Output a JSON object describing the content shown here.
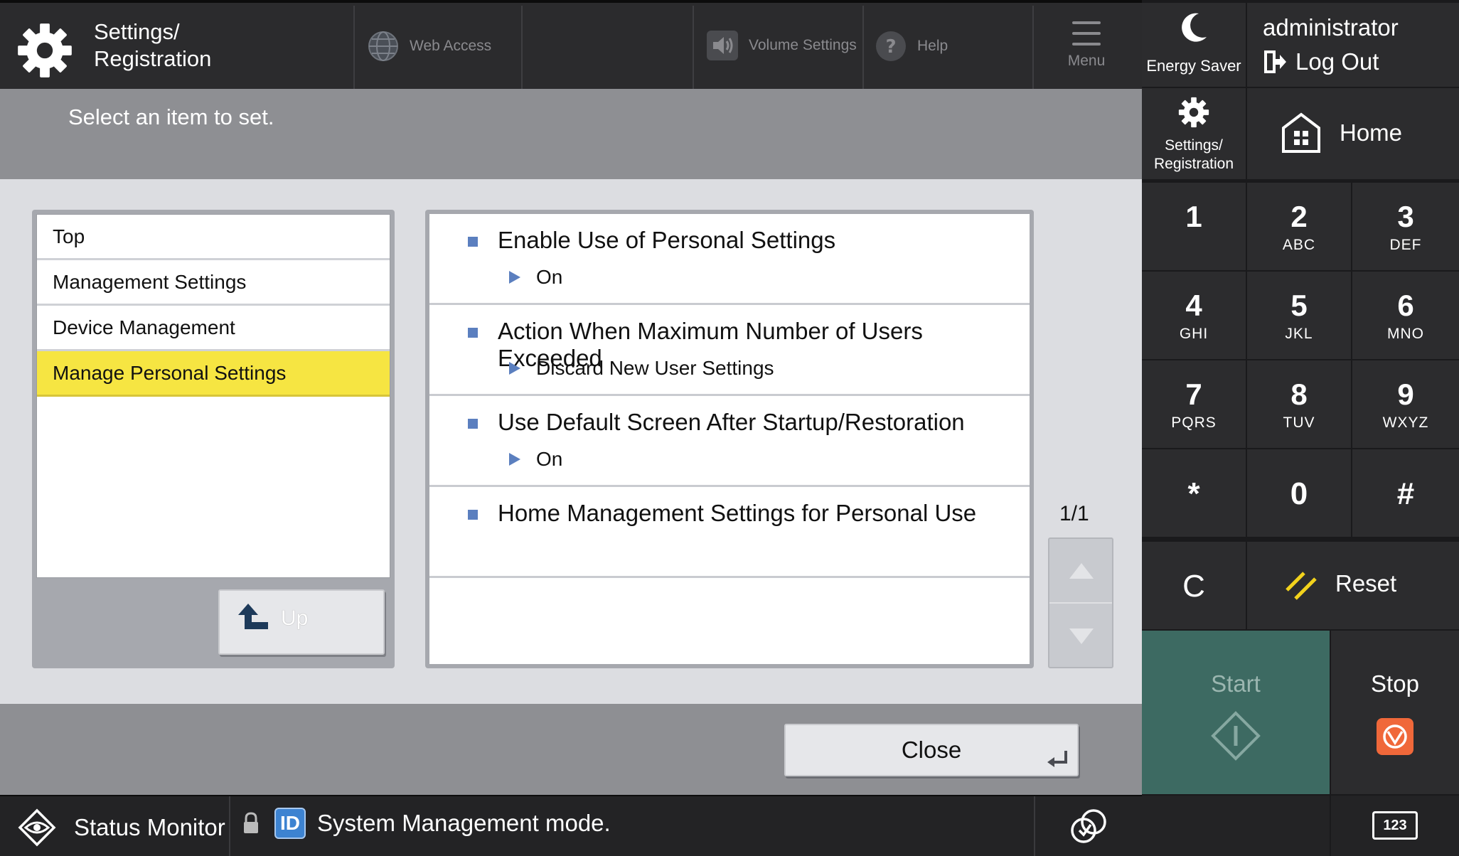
{
  "header": {
    "app_title_line1": "Settings/",
    "app_title_line2": "Registration",
    "web_access": "Web Access",
    "volume_settings": "Volume Settings",
    "help": "Help",
    "menu": "Menu"
  },
  "prompt": "Select an item to set.",
  "tree": {
    "items": [
      {
        "label": "Top",
        "selected": false
      },
      {
        "label": "Management Settings",
        "selected": false
      },
      {
        "label": "Device Management",
        "selected": false
      },
      {
        "label": "Manage Personal Settings",
        "selected": true
      }
    ],
    "up_label": "Up"
  },
  "settings": {
    "rows": [
      {
        "title": "Enable Use of Personal Settings",
        "value": "On"
      },
      {
        "title": "Action When Maximum Number of Users Exceeded",
        "value": "Discard New User Settings"
      },
      {
        "title": "Use Default Screen After Startup/Restoration",
        "value": "On"
      },
      {
        "title": "Home Management Settings for Personal Use",
        "value": ""
      }
    ],
    "page_indicator": "1/1"
  },
  "footer": {
    "close_label": "Close"
  },
  "statusbar": {
    "status_monitor": "Status Monitor",
    "id_badge": "ID",
    "mode_text": "System Management mode."
  },
  "panel": {
    "energy_saver": "Energy Saver",
    "user_name": "administrator",
    "log_out": "Log Out",
    "settings_line1": "Settings/",
    "settings_line2": "Registration",
    "home": "Home",
    "keys": [
      {
        "digit": "1",
        "letters": ""
      },
      {
        "digit": "2",
        "letters": "ABC"
      },
      {
        "digit": "3",
        "letters": "DEF"
      },
      {
        "digit": "4",
        "letters": "GHI"
      },
      {
        "digit": "5",
        "letters": "JKL"
      },
      {
        "digit": "6",
        "letters": "MNO"
      },
      {
        "digit": "7",
        "letters": "PQRS"
      },
      {
        "digit": "8",
        "letters": "TUV"
      },
      {
        "digit": "9",
        "letters": "WXYZ"
      },
      {
        "digit": "*",
        "letters": ""
      },
      {
        "digit": "0",
        "letters": ""
      },
      {
        "digit": "#",
        "letters": ""
      }
    ],
    "clear_key": "C",
    "reset": "Reset",
    "start": "Start",
    "stop": "Stop",
    "keypad_toggle": "123"
  },
  "colors": {
    "selected_highlight": "#f6e542",
    "bullet_blue": "#5b7fbf",
    "start_green": "#3d6a62",
    "stop_orange": "#f0683a",
    "reset_yellow": "#f2d21c"
  },
  "icons": [
    "gear-icon",
    "globe-icon",
    "speaker-icon",
    "help-icon",
    "menu-icon",
    "up-arrow-icon",
    "eye-icon",
    "lock-icon",
    "sync-icon",
    "moon-icon",
    "logout-icon",
    "home-icon",
    "reset-icon",
    "start-icon",
    "stop-icon",
    "keypad-icon"
  ]
}
